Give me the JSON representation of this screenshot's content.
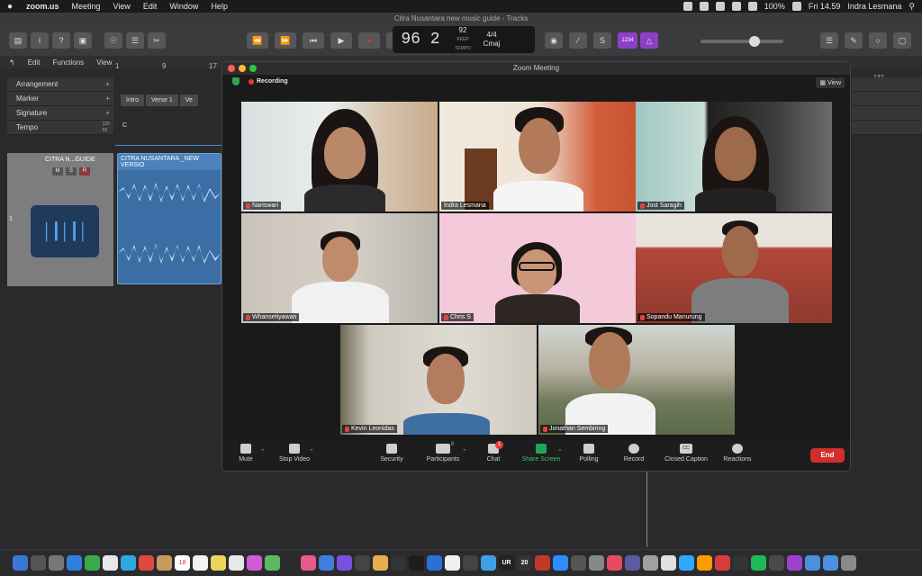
{
  "menubar": {
    "apple": "",
    "app_name": "zoom.us",
    "items": [
      "Meeting",
      "View",
      "Edit",
      "Window",
      "Help"
    ],
    "battery": "100%",
    "clock": "Fri 14.59",
    "user": "Indra Lesmana"
  },
  "logic": {
    "window_title": "Citra Nusantara new music guide - Tracks",
    "lcd": {
      "bar": "96",
      "beat": "2",
      "tempo": "92",
      "tempo_label": "KEEP",
      "tempo_sub": "TEMPO",
      "bar_label": "BAR",
      "beat_label": "BEAT",
      "sig": "4/4",
      "key": "Cmaj"
    },
    "counter_label": "1234",
    "toolbar2": {
      "edit": "Edit",
      "functions": "Functions",
      "view": "View"
    },
    "ruler": [
      "1",
      "9",
      "17"
    ],
    "ruler_right": "137",
    "global_tracks": [
      "Arrangement",
      "Marker",
      "Signature",
      "Tempo"
    ],
    "markers": [
      "Intro",
      "Verse 1",
      "Ve"
    ],
    "signature_key": "C",
    "tempo_values": [
      "120",
      "60"
    ],
    "track": {
      "number": "1",
      "name": "CITRA N...GUIDE",
      "m": "M",
      "s": "S",
      "r": "R"
    },
    "region_name": "CITRA NUSANTARA _NEW VERSIO"
  },
  "zoom": {
    "window_title": "Zoom Meeting",
    "recording_label": "Recording",
    "view_label": "View",
    "participants": [
      {
        "name": "Nariswari",
        "active": true
      },
      {
        "name": "Indra Lesmana",
        "active": false
      },
      {
        "name": "Jost Saragih",
        "active": false
      },
      {
        "name": "Whansetiyawan",
        "active": false
      },
      {
        "name": "Chris S",
        "active": false
      },
      {
        "name": "Sopandu Manurung",
        "active": false
      },
      {
        "name": "Kevin Leonidas",
        "active": false
      },
      {
        "name": "Jonathan Sembiring",
        "active": false
      }
    ],
    "controls": {
      "mute": "Mute",
      "stop_video": "Stop Video",
      "security": "Security",
      "participants": "Participants",
      "participants_count": "8",
      "chat": "Chat",
      "chat_badge": "1",
      "share_screen": "Share Screen",
      "polling": "Polling",
      "record": "Record",
      "closed_caption": "Closed Caption",
      "closed_caption_icon": "CC",
      "reactions": "Reactions",
      "end": "End"
    }
  },
  "colors": {
    "active_speaker": "#b9e15a",
    "share_green": "#21a25a",
    "end_red": "#d42d2d",
    "recording_red": "#e53b3b",
    "logic_region_blue": "#3a6ea5"
  },
  "dock": {
    "badges": [
      "18",
      "UR",
      "20"
    ]
  }
}
